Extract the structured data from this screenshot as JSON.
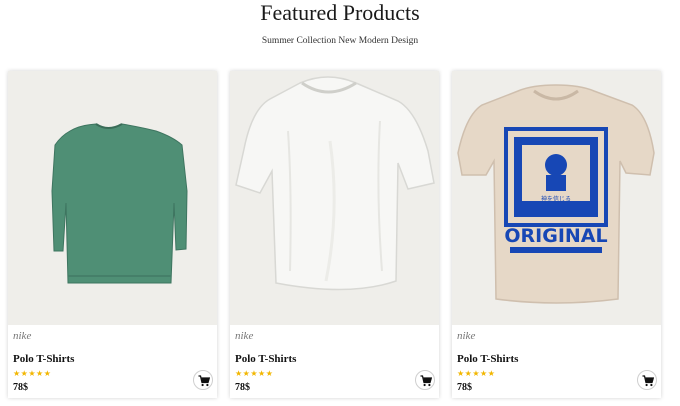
{
  "section": {
    "title": "Featured Products",
    "subtitle": "Summer Collection New Modern Design"
  },
  "theme": {
    "star_color": "#f2b600",
    "card_image_bg": "#efeeea"
  },
  "products": [
    {
      "brand": "nike",
      "name": "Polo T-Shirts",
      "stars": "★★★★★",
      "rating": 5,
      "price": "78$",
      "image": "green-long-sleeve-shirt"
    },
    {
      "brand": "nike",
      "name": "Polo T-Shirts",
      "stars": "★★★★★",
      "rating": 5,
      "price": "78$",
      "image": "white-t-shirt"
    },
    {
      "brand": "nike",
      "name": "Polo T-Shirts",
      "stars": "★★★★★",
      "rating": 5,
      "price": "78$",
      "image": "beige-original-print-t-shirt",
      "print_text": "ORIGINAL"
    }
  ]
}
